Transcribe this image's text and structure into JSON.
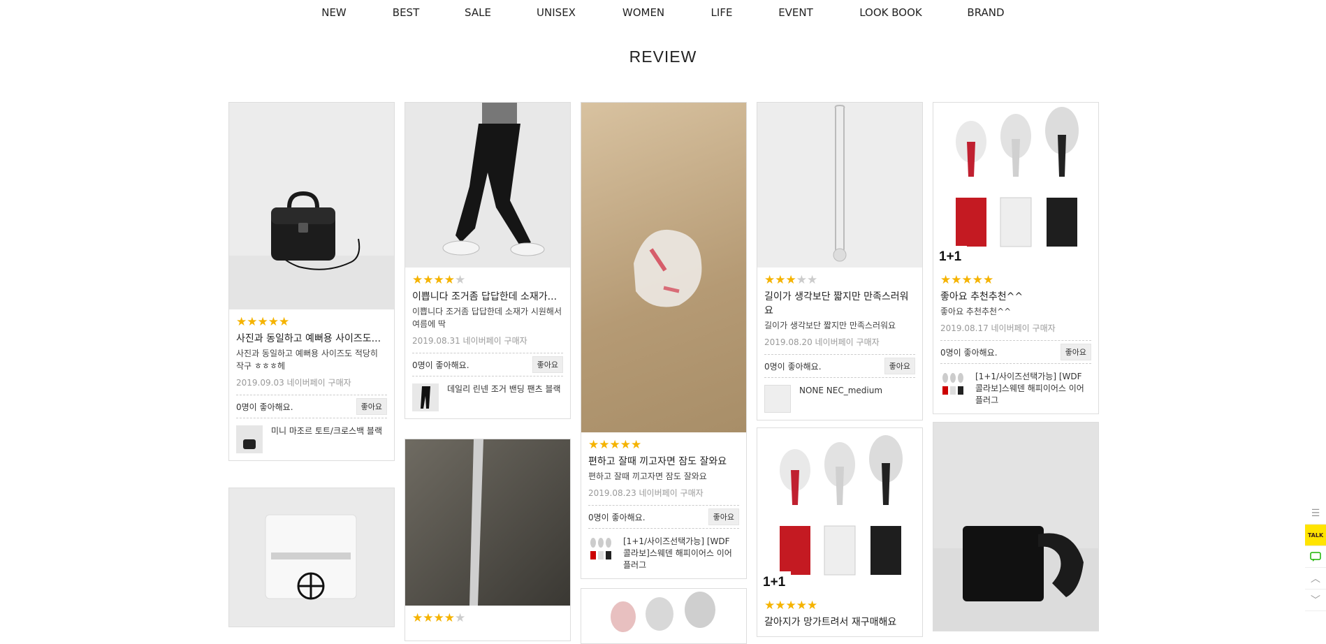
{
  "nav": [
    "NEW",
    "BEST",
    "SALE",
    "UNISEX",
    "WOMEN",
    "LIFE",
    "EVENT",
    "LOOK BOOK",
    "BRAND"
  ],
  "page_title": "REVIEW",
  "like_button": "좋아요",
  "reviews": [
    {
      "stars": "★★★★★",
      "stars_off": "",
      "rating": 5,
      "title": "사진과 동일하고 예뻐용 사이즈도...",
      "body": "사진과 동일하고 예뻐용 사이즈도 적당히 작구 ㅎㅎㅎ헤",
      "date": "2019.09.03 네이버페이 구매자",
      "likes": "0명이 좋아해요.",
      "product": "미니 마조르 토트/크로스백 블랙"
    },
    {
      "stars": "★★★★",
      "stars_off": "★",
      "rating": 4,
      "title": "이쁩니다 조거좀 답답한데 소재가...",
      "body": "이쁩니다 조거좀 답답한데 소재가 시원해서 여름에 딱",
      "date": "2019.08.31 네이버페이 구매자",
      "likes": "0명이 좋아해요.",
      "product": "데일리 린넨 조거 밴딩 팬츠 블랙"
    },
    {
      "stars": "★★★★★",
      "stars_off": "",
      "rating": 5,
      "title": "편하고 잘때 끼고자면 잠도 잘와요",
      "body": "편하고 잘때 끼고자면 잠도 잘와요",
      "date": "2019.08.23 네이버페이 구매자",
      "likes": "0명이 좋아해요.",
      "product": "[1+1/사이즈선택가능] [WDF 콜라보]스웨덴 해피이어스 이어플러그"
    },
    {
      "stars": "★★★",
      "stars_off": "★★",
      "rating": 3,
      "title": "길이가 생각보단 짧지만 만족스러워요",
      "body": "길이가 생각보단 짧지만 만족스러워요",
      "date": "2019.08.20 네이버페이 구매자",
      "likes": "0명이 좋아해요.",
      "product": "NONE NEC_medium"
    },
    {
      "stars": "★★★★★",
      "stars_off": "",
      "rating": 5,
      "title": "좋아요 추천추천^^",
      "body": "좋아요 추천추천^^",
      "date": "2019.08.17 네이버페이 구매자",
      "likes": "0명이 좋아해요.",
      "product": "[1+1/사이즈선택가능] [WDF 콜라보]스웨덴 해피이어스 이어플러그"
    },
    {
      "stars": "★★★★",
      "stars_off": "★",
      "rating": 4,
      "title": "",
      "body": "",
      "date": "",
      "likes": "",
      "product": ""
    },
    {
      "stars": "★★★★★",
      "stars_off": "",
      "rating": 5,
      "title": "갈아지가 망가트려서 재구매해요",
      "body": "",
      "date": "",
      "likes": "",
      "product": ""
    }
  ],
  "badge": "1+1",
  "sidebar": {
    "menu_icon": "☰",
    "talk": "TALK",
    "up": "︿",
    "down": "﹀"
  }
}
